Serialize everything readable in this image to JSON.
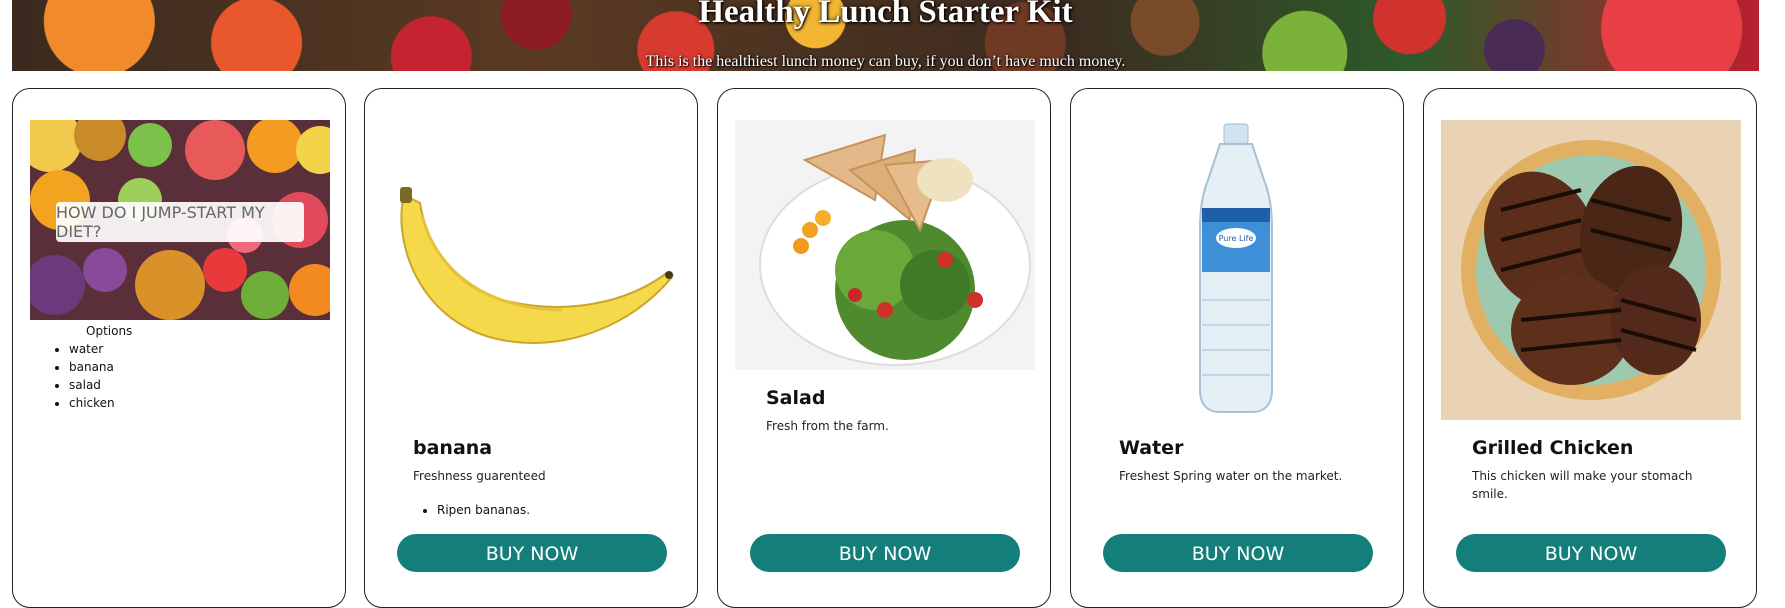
{
  "header": {
    "title": "Healthy Lunch Starter Kit",
    "subtitle": "This is the healthiest lunch money can buy, if you don’t have much money."
  },
  "intro_card": {
    "image_caption": "HOW DO I JUMP-START MY DIET?",
    "options_heading": "Options",
    "options": [
      "water",
      "banana",
      "salad",
      "chicken"
    ]
  },
  "products": [
    {
      "id": "banana",
      "title": "banana",
      "description": "Freshness guarenteed",
      "bullets": [
        "Ripen bananas."
      ],
      "button": "BUY NOW"
    },
    {
      "id": "salad",
      "title": "Salad",
      "description": "Fresh from the farm.",
      "button": "BUY NOW"
    },
    {
      "id": "water",
      "title": "Water",
      "description": "Freshest Spring water on the market.",
      "bottle_label": "Pure Life",
      "button": "BUY NOW"
    },
    {
      "id": "chicken",
      "title": "Grilled Chicken",
      "description": "This chicken will make your stomach smile.",
      "button": "BUY NOW"
    }
  ],
  "colors": {
    "button": "#147f7a",
    "button_text": "#ffffff",
    "card_border": "#222222"
  }
}
